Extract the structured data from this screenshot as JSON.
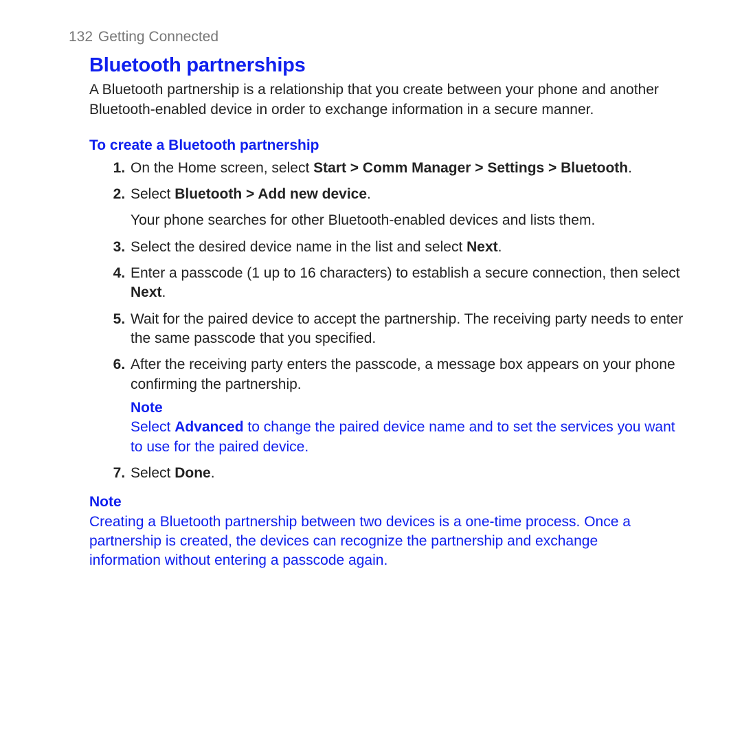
{
  "header": {
    "pageNumber": "132",
    "chapter": "Getting Connected"
  },
  "h1": "Bluetooth partnerships",
  "intro": "A Bluetooth partnership is a relationship that you create between your phone and another Bluetooth-enabled device in order to exchange information in a secure manner.",
  "h2": "To create a Bluetooth partnership",
  "steps": {
    "s1_a": "On the Home screen, select ",
    "s1_b": "Start > Comm Manager > Settings > Bluetooth",
    "s1_c": ".",
    "s2_a": "Select ",
    "s2_b": "Bluetooth > Add new device",
    "s2_c": ".",
    "s2_extra": "Your phone searches for other Bluetooth-enabled devices and lists them.",
    "s3_a": "Select the desired device name in the list and select ",
    "s3_b": "Next",
    "s3_c": ".",
    "s4_a": "Enter a passcode (1 up to 16 characters) to establish a secure connection, then select ",
    "s4_b": "Next",
    "s4_c": ".",
    "s5": "Wait for the paired device to accept the partnership. The receiving party needs to enter the same passcode that you specified.",
    "s6": "After the receiving party enters the passcode, a message box appears on your phone confirming the partnership.",
    "note6_label": "Note",
    "note6_a": "Select ",
    "note6_b": "Advanced",
    "note6_c": " to change the paired device name and to set the services you want to use for the paired device.",
    "s7_a": "Select ",
    "s7_b": "Done",
    "s7_c": "."
  },
  "footnote": {
    "label": "Note",
    "body": "Creating a Bluetooth partnership between two devices is a one-time process. Once a partnership is created, the devices can recognize the partnership and exchange information without entering a passcode again."
  }
}
